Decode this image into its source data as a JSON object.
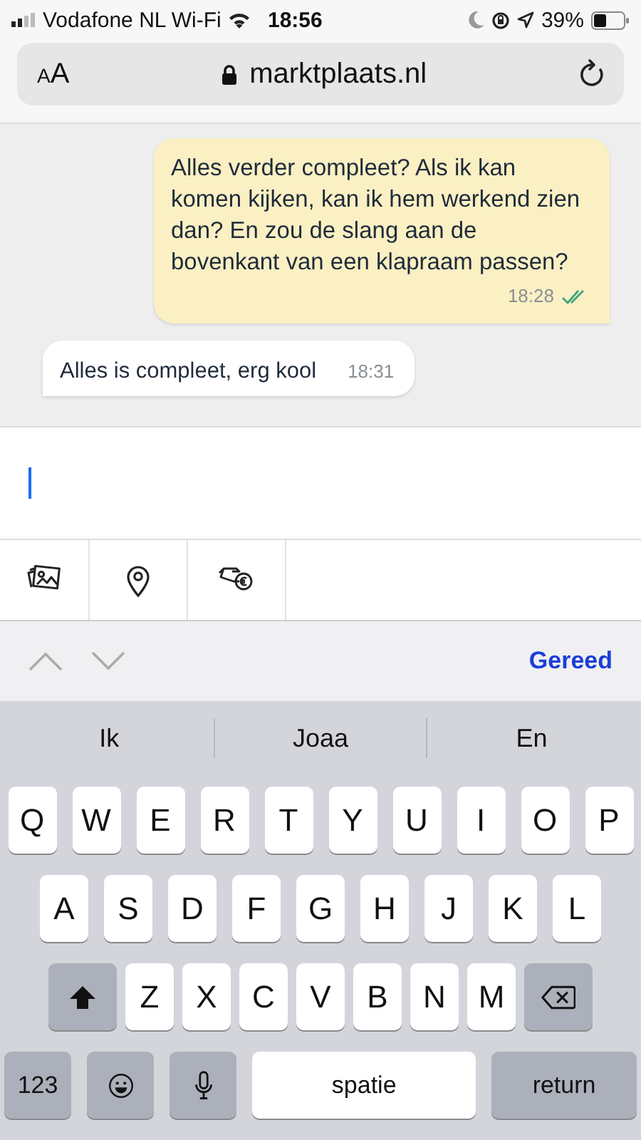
{
  "status_bar": {
    "carrier": "Vodafone NL Wi-Fi",
    "time": "18:56",
    "battery": "39%"
  },
  "browser": {
    "text_size": "AA",
    "url": "marktplaats.nl"
  },
  "messages": [
    {
      "kind": "sent",
      "text": "Alles verder compleet? Als ik kan komen kijken, kan ik hem werkend zien dan? En zou de slang aan de bovenkant van een klapraam passen?",
      "time": "18:28",
      "read": true
    },
    {
      "kind": "received",
      "text": "Alles is compleet, erg kool",
      "time": "18:31",
      "read": false
    }
  ],
  "composer": {
    "focused": true
  },
  "attachments": [
    {
      "kind": "photo"
    },
    {
      "kind": "location"
    },
    {
      "kind": "payment"
    }
  ],
  "toolbar": {
    "done": "Gereed"
  },
  "suggestions": [
    "Ik",
    "Joaa",
    "En"
  ],
  "keyboard": {
    "top_row": [
      {
        "kind": "letter",
        "label": "Q"
      },
      {
        "kind": "letter",
        "label": "W"
      },
      {
        "kind": "letter",
        "label": "E"
      },
      {
        "kind": "letter",
        "label": "R"
      },
      {
        "kind": "letter",
        "label": "T"
      },
      {
        "kind": "letter",
        "label": "Y"
      },
      {
        "kind": "letter",
        "label": "U"
      },
      {
        "kind": "letter",
        "label": "I"
      },
      {
        "kind": "letter",
        "label": "O"
      },
      {
        "kind": "letter",
        "label": "P"
      }
    ],
    "home_row": [
      {
        "kind": "letter",
        "label": "A"
      },
      {
        "kind": "letter",
        "label": "S"
      },
      {
        "kind": "letter",
        "label": "D"
      },
      {
        "kind": "letter",
        "label": "F"
      },
      {
        "kind": "letter",
        "label": "G"
      },
      {
        "kind": "letter",
        "label": "H"
      },
      {
        "kind": "letter",
        "label": "J"
      },
      {
        "kind": "letter",
        "label": "K"
      },
      {
        "kind": "letter",
        "label": "L"
      }
    ],
    "bottom_letter_row": [
      {
        "kind": "shift"
      },
      {
        "kind": "letter",
        "label": "Z"
      },
      {
        "kind": "letter",
        "label": "X"
      },
      {
        "kind": "letter",
        "label": "C"
      },
      {
        "kind": "letter",
        "label": "V"
      },
      {
        "kind": "letter",
        "label": "B"
      },
      {
        "kind": "letter",
        "label": "N"
      },
      {
        "kind": "letter",
        "label": "M"
      },
      {
        "kind": "backspace"
      }
    ],
    "function_row": [
      {
        "kind": "mode",
        "label": "123"
      },
      {
        "kind": "emoji"
      },
      {
        "kind": "mic"
      },
      {
        "kind": "space",
        "label": "spatie"
      },
      {
        "kind": "return",
        "label": "return"
      }
    ]
  }
}
